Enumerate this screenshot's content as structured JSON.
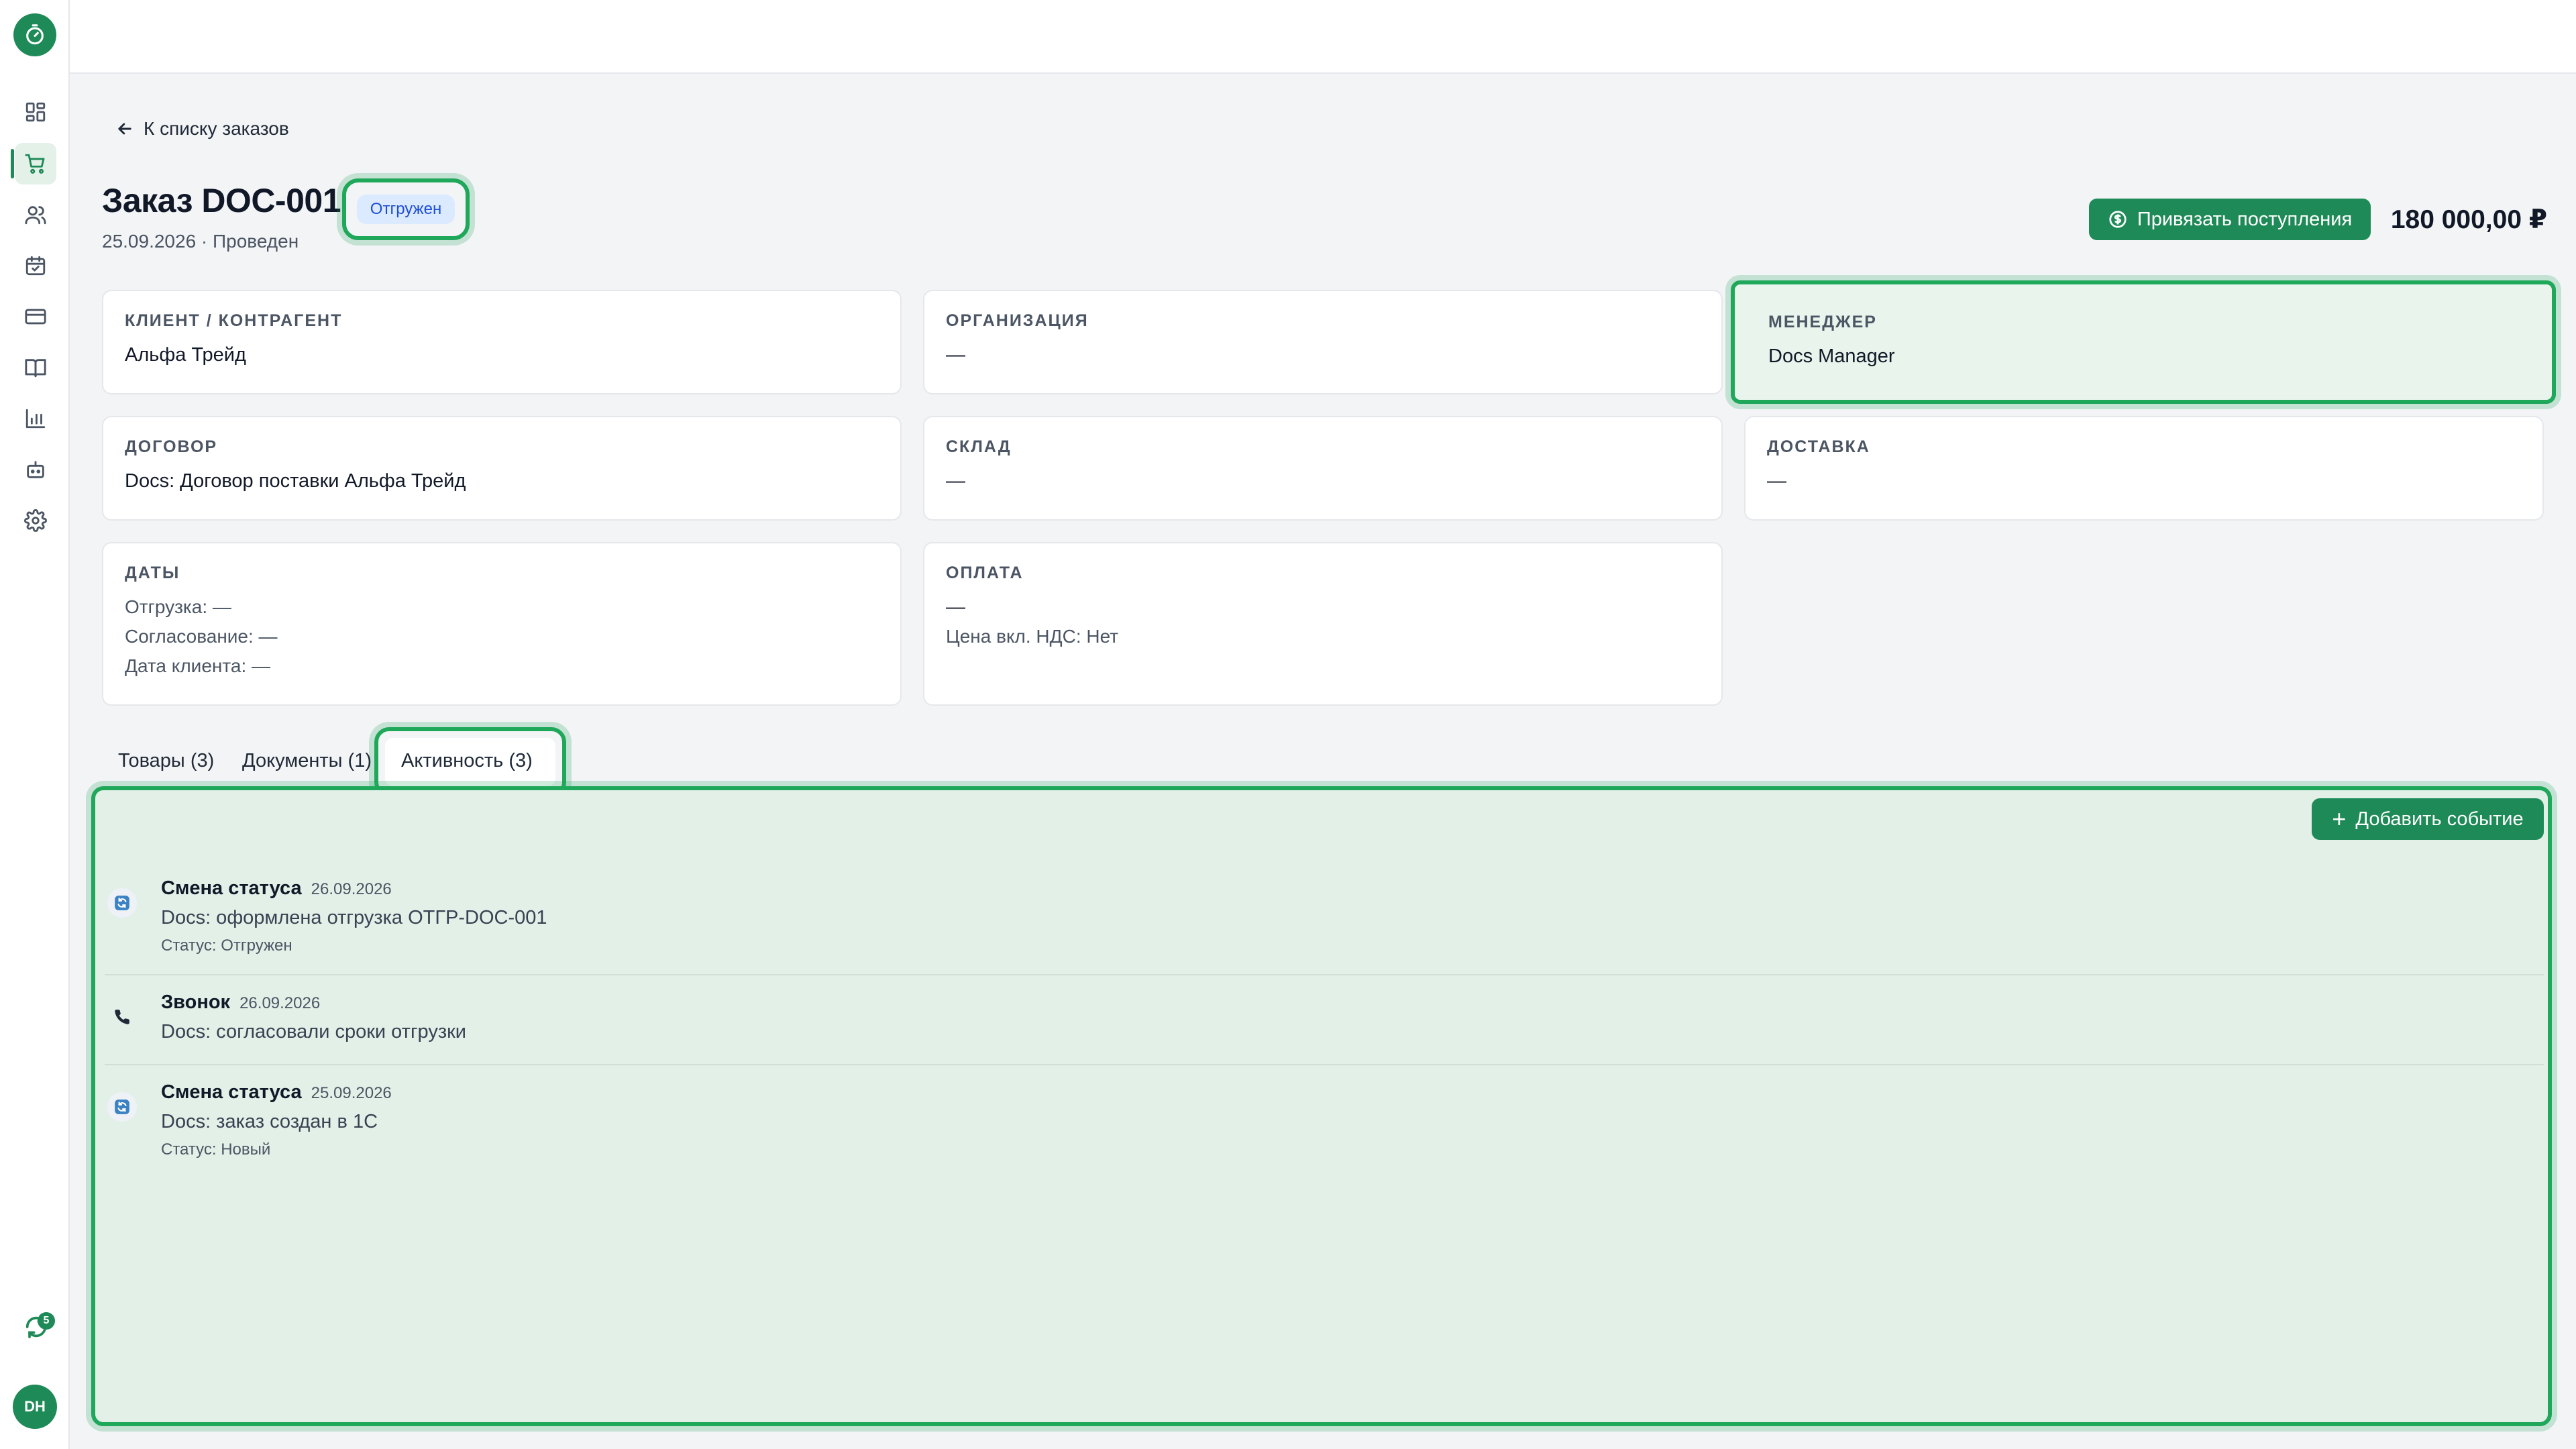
{
  "sidebar": {
    "logo_icon": "stopwatch-icon",
    "items": [
      {
        "icon": "dashboard-icon",
        "active": false
      },
      {
        "icon": "cart-icon",
        "active": true
      },
      {
        "icon": "users-icon",
        "active": false
      },
      {
        "icon": "calendar-check-icon",
        "active": false
      },
      {
        "icon": "credit-card-icon",
        "active": false
      },
      {
        "icon": "book-icon",
        "active": false
      },
      {
        "icon": "bar-chart-icon",
        "active": false
      },
      {
        "icon": "bot-icon",
        "active": false
      },
      {
        "icon": "gear-icon",
        "active": false
      }
    ],
    "sync_badge": "5",
    "avatar_initials": "DH"
  },
  "back_link": "К списку заказов",
  "order": {
    "title": "Заказ DOC-001",
    "status": "Отгружен",
    "subtitle": "25.09.2026 · Проведен",
    "link_button": "Привязать поступления",
    "total": "180 000,00 ₽"
  },
  "cards": {
    "client": {
      "label": "Клиент / контрагент",
      "value": "Альфа Трейд"
    },
    "organization": {
      "label": "Организация",
      "value": "—"
    },
    "manager": {
      "label": "Менеджер",
      "value": "Docs Manager"
    },
    "contract": {
      "label": "Договор",
      "value": "Docs: Договор поставки Альфа Трейд"
    },
    "warehouse": {
      "label": "Склад",
      "value": "—"
    },
    "delivery": {
      "label": "Доставка",
      "value": "—"
    },
    "dates": {
      "label": "Даты",
      "shipment": "Отгрузка: —",
      "approval": "Согласование: —",
      "client_date": "Дата клиента: —"
    },
    "payment": {
      "label": "Оплата",
      "value": "—",
      "vat": "Цена вкл. НДС: Нет"
    }
  },
  "tabs": [
    {
      "label": "Товары (3)",
      "active": false
    },
    {
      "label": "Документы (1)",
      "active": false
    },
    {
      "label": "Активность (3)",
      "active": true
    }
  ],
  "activity": {
    "add_button": "Добавить событие",
    "events": [
      {
        "icon": "refresh-icon",
        "title": "Смена статуса",
        "date": "26.09.2026",
        "text": "Docs: оформлена отгрузка ОТГР-DOC-001",
        "sub": "Статус: Отгружен"
      },
      {
        "icon": "phone-icon",
        "title": "Звонок",
        "date": "26.09.2026",
        "text": "Docs: согласовали сроки отгрузки",
        "sub": ""
      },
      {
        "icon": "refresh-icon",
        "title": "Смена статуса",
        "date": "25.09.2026",
        "text": "Docs: заказ создан в 1С",
        "sub": "Статус: Новый"
      }
    ]
  },
  "colors": {
    "brand": "#1e8a57",
    "highlight": "#1fa85a",
    "status_badge_bg": "#dbeafe",
    "status_badge_text": "#1d4ed8"
  }
}
